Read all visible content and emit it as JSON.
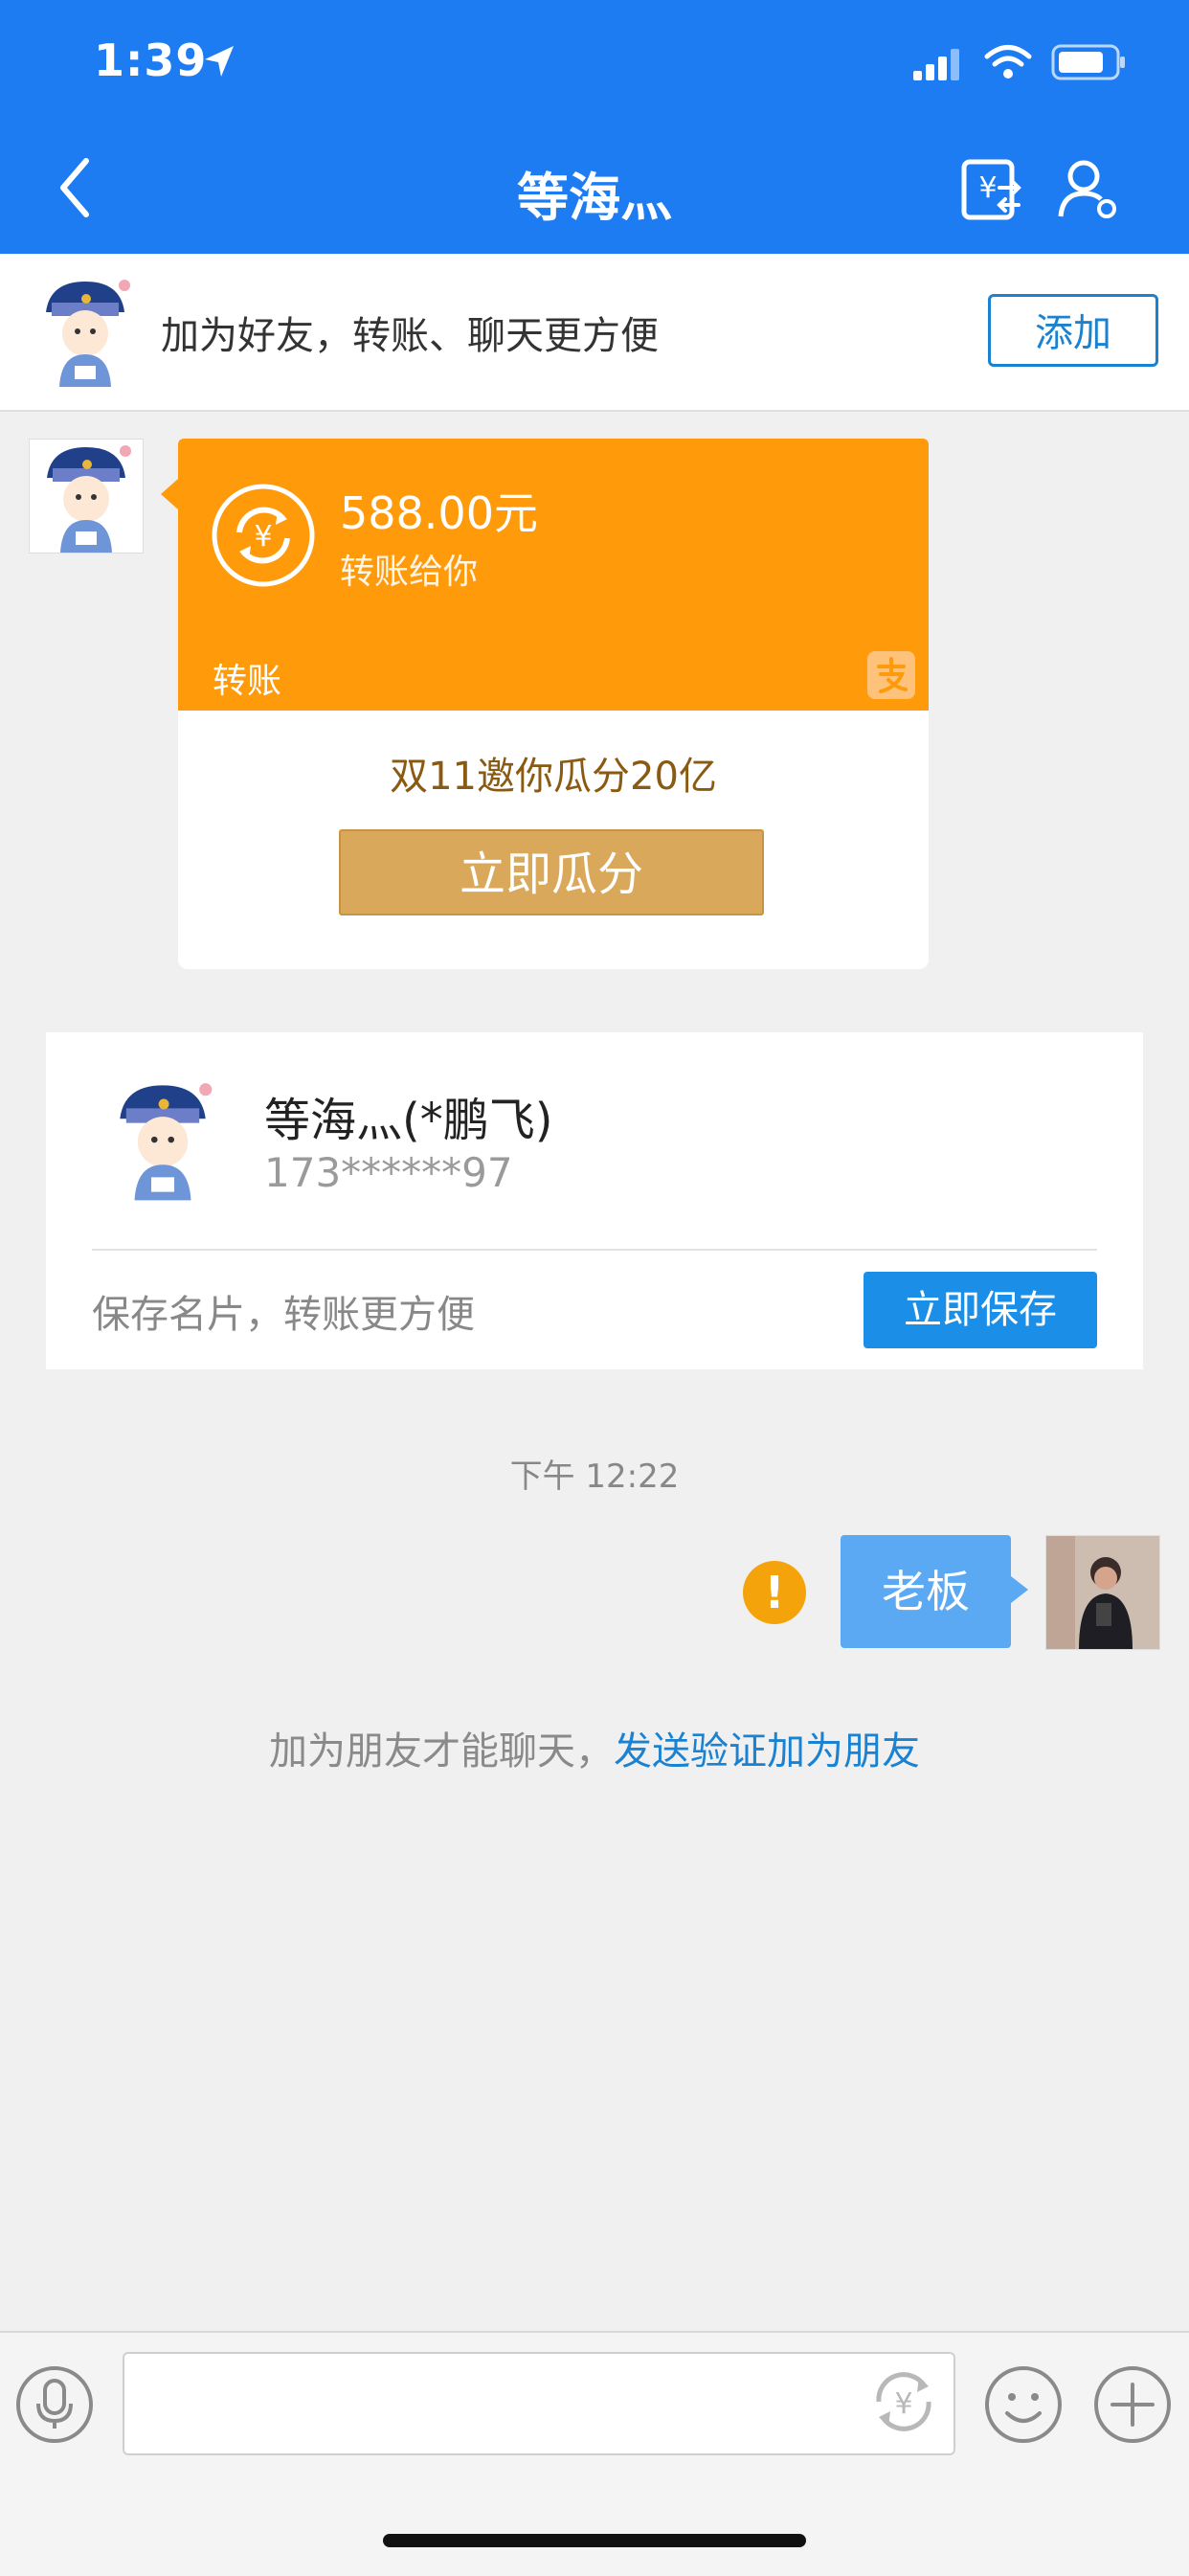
{
  "status_bar": {
    "time": "1:39"
  },
  "nav": {
    "title": "等海灬"
  },
  "friend_bar": {
    "text": "加为好友，转账、聊天更方便",
    "add_label": "添加"
  },
  "transfer_card": {
    "amount": "588.00元",
    "subtitle": "转账给你",
    "label": "转账",
    "promo_text": "双11邀你瓜分20亿",
    "promo_button": "立即瓜分"
  },
  "contact_card": {
    "name": "等海灬(*鹏飞)",
    "phone": "173******97",
    "save_text": "保存名片，转账更方便",
    "save_button": "立即保存"
  },
  "timestamp": "下午 12:22",
  "message": {
    "text": "老板",
    "status": "failed"
  },
  "system_notice": {
    "prefix": "加为朋友才能聊天，",
    "link": "发送验证加为朋友"
  },
  "colors": {
    "primary": "#1d7cf2",
    "transfer_orange": "#ff9a0b",
    "warning": "#f4a30b",
    "bubble": "#5aa9f2",
    "link": "#1b82d1"
  },
  "icons": {
    "back": "chevron-left-icon",
    "transfer": "yuan-transfer-icon",
    "profile": "user-settings-icon",
    "voice": "microphone-icon",
    "emoji": "smiley-icon",
    "more": "plus-icon",
    "quick_transfer": "yuan-refresh-icon"
  }
}
